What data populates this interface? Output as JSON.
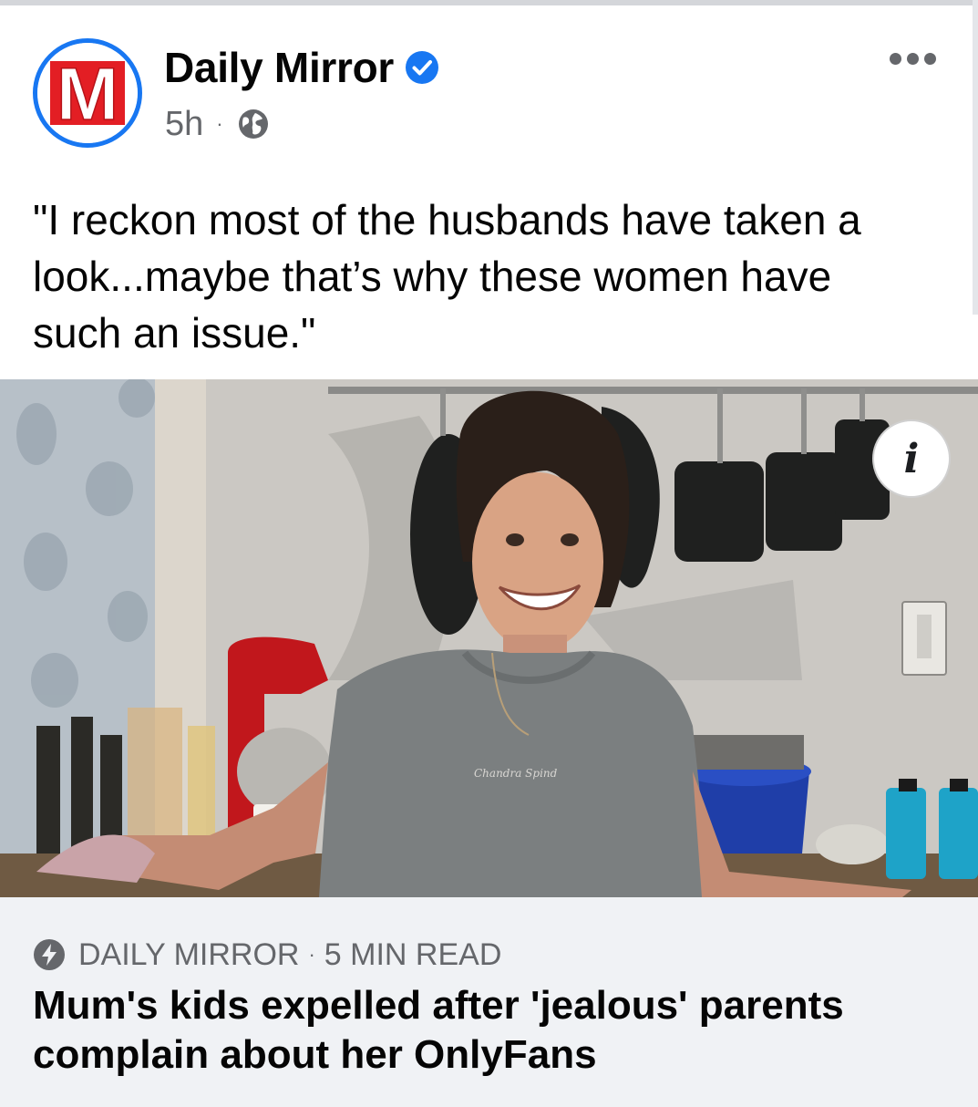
{
  "post": {
    "page_name": "Daily Mirror",
    "avatar_letter": "M",
    "verified_icon": "verified-badge-icon",
    "time_ago": "5h",
    "separator": "·",
    "audience_icon": "globe-icon",
    "more_icon": "more-options-icon",
    "caption_lines": [
      "\"I reckon most of the husbands have taken a",
      "look...maybe that’s why these women have",
      "such an issue.\""
    ]
  },
  "image": {
    "info_label": "i",
    "info_icon": "info-icon",
    "sweater_text": "Chandra Spind"
  },
  "link_preview": {
    "source_icon": "lightning-bolt-icon",
    "source": "DAILY MIRROR",
    "separator": "·",
    "read_time": "5 MIN READ",
    "headline_lines": [
      "Mum's kids expelled after 'jealous' parents",
      "complain about her OnlyFans"
    ]
  },
  "colors": {
    "accent": "#1877f2",
    "brand_red": "#e31e24",
    "text_primary": "#050505",
    "text_secondary": "#65676b",
    "preview_bg": "#f0f2f5"
  }
}
